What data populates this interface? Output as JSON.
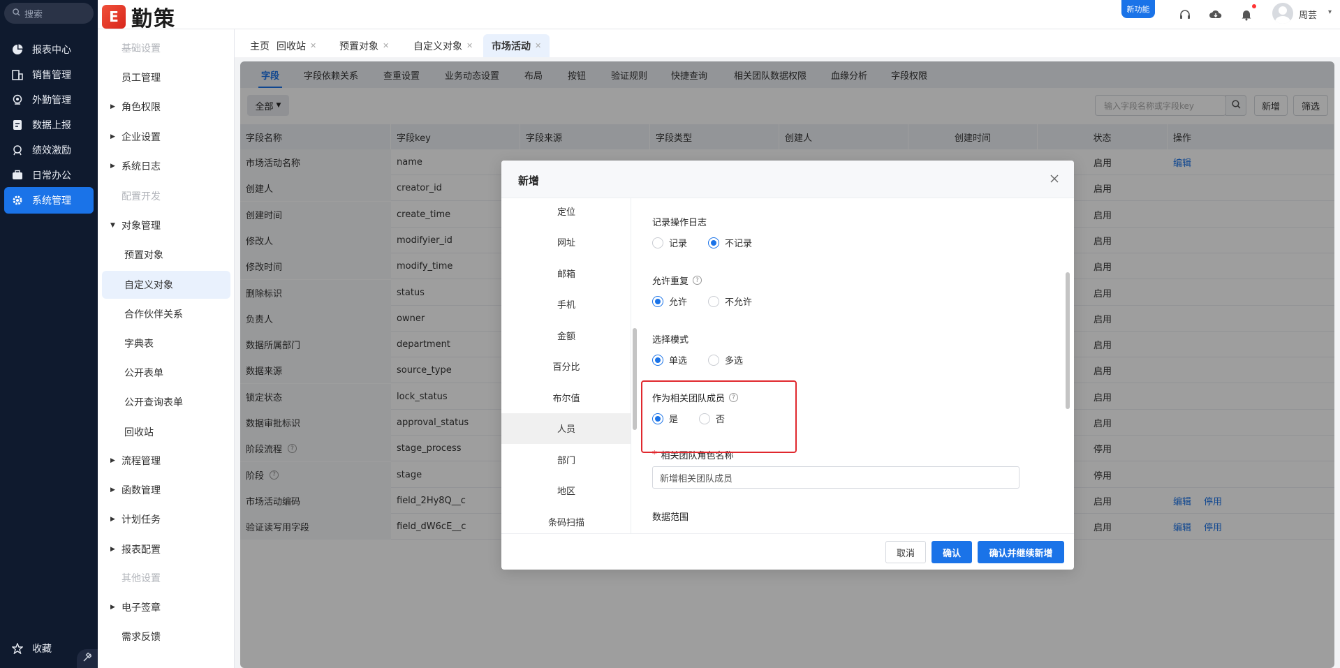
{
  "nav": {
    "search_placeholder": "搜索",
    "items": [
      {
        "label": "报表中心",
        "icon": "pie-chart-icon"
      },
      {
        "label": "销售管理",
        "icon": "building-icon"
      },
      {
        "label": "外勤管理",
        "icon": "location-icon"
      },
      {
        "label": "数据上报",
        "icon": "report-icon"
      },
      {
        "label": "绩效激励",
        "icon": "medal-icon"
      },
      {
        "label": "日常办公",
        "icon": "briefcase-icon"
      },
      {
        "label": "系统管理",
        "icon": "gear-icon",
        "active": true
      }
    ],
    "favorites_label": "收藏"
  },
  "brand": {
    "name": "勤策",
    "mark": "E"
  },
  "topbar": {
    "new_feature": "新功能",
    "username": "周芸"
  },
  "side": {
    "items": [
      {
        "label": "基础设置",
        "type": "group"
      },
      {
        "label": "员工管理",
        "type": "item"
      },
      {
        "label": "角色权限",
        "type": "collapsed"
      },
      {
        "label": "企业设置",
        "type": "collapsed"
      },
      {
        "label": "系统日志",
        "type": "collapsed"
      },
      {
        "label": "配置开发",
        "type": "group"
      },
      {
        "label": "对象管理",
        "type": "expanded"
      },
      {
        "label": "预置对象",
        "type": "sub"
      },
      {
        "label": "自定义对象",
        "type": "sub",
        "active": true
      },
      {
        "label": "合作伙伴关系",
        "type": "sub"
      },
      {
        "label": "字典表",
        "type": "sub"
      },
      {
        "label": "公开表单",
        "type": "sub"
      },
      {
        "label": "公开查询表单",
        "type": "sub"
      },
      {
        "label": "回收站",
        "type": "sub"
      },
      {
        "label": "流程管理",
        "type": "collapsed"
      },
      {
        "label": "函数管理",
        "type": "collapsed"
      },
      {
        "label": "计划任务",
        "type": "collapsed"
      },
      {
        "label": "报表配置",
        "type": "collapsed"
      },
      {
        "label": "其他设置",
        "type": "group"
      },
      {
        "label": "电子签章",
        "type": "collapsed"
      },
      {
        "label": "需求反馈",
        "type": "item"
      }
    ]
  },
  "page_tabs": [
    {
      "label": "主页",
      "closable": false
    },
    {
      "label": "回收站",
      "closable": true
    },
    {
      "label": "预置对象",
      "closable": true
    },
    {
      "label": "自定义对象",
      "closable": true
    },
    {
      "label": "市场活动",
      "closable": true,
      "active": true
    }
  ],
  "field_tabs": [
    "字段",
    "字段依赖关系",
    "查重设置",
    "业务动态设置",
    "布局",
    "按钮",
    "验证规则",
    "快捷查询",
    "相关团队数据权限",
    "血缘分析",
    "字段权限"
  ],
  "toolbar": {
    "filter_all": "全部",
    "search_placeholder": "输入字段名称或字段key",
    "add_label": "新增",
    "filter_label": "筛选"
  },
  "table": {
    "columns": [
      "字段名称",
      "字段key",
      "字段来源",
      "字段类型",
      "创建人",
      "创建时间",
      "状态",
      "操作"
    ],
    "rows": [
      {
        "name": "市场活动名称",
        "key": "name",
        "source": "",
        "type": "",
        "creator": "",
        "created": "",
        "status": "启用",
        "actions": [
          "编辑"
        ]
      },
      {
        "name": "创建人",
        "key": "creator_id",
        "status": "启用",
        "actions": []
      },
      {
        "name": "创建时间",
        "key": "create_time",
        "status": "启用",
        "actions": []
      },
      {
        "name": "修改人",
        "key": "modifyier_id",
        "status": "启用",
        "actions": []
      },
      {
        "name": "修改时间",
        "key": "modify_time",
        "status": "启用",
        "actions": []
      },
      {
        "name": "删除标识",
        "key": "status",
        "status": "启用",
        "actions": []
      },
      {
        "name": "负责人",
        "key": "owner",
        "status": "启用",
        "actions": []
      },
      {
        "name": "数据所属部门",
        "key": "department",
        "status": "启用",
        "actions": []
      },
      {
        "name": "数据来源",
        "key": "source_type",
        "status": "启用",
        "actions": []
      },
      {
        "name": "锁定状态",
        "key": "lock_status",
        "status": "启用",
        "actions": []
      },
      {
        "name": "数据审批标识",
        "key": "approval_status",
        "status": "启用",
        "actions": []
      },
      {
        "name": "阶段流程",
        "key": "stage_process",
        "status": "停用",
        "help": true,
        "actions": []
      },
      {
        "name": "阶段",
        "key": "stage",
        "status": "停用",
        "help": true,
        "actions": []
      },
      {
        "name": "市场活动编码",
        "key": "field_2Hy8Q__c",
        "status": "启用",
        "actions": [
          "编辑",
          "停用"
        ]
      },
      {
        "name": "验证读写用字段",
        "key": "field_dW6cE__c",
        "status": "启用",
        "actions": [
          "编辑",
          "停用"
        ]
      }
    ]
  },
  "modal": {
    "title": "新增",
    "field_types": [
      "定位",
      "网址",
      "邮箱",
      "手机",
      "金额",
      "百分比",
      "布尔值",
      "人员",
      "部门",
      "地区",
      "条码扫描"
    ],
    "active_type": "人员",
    "sections": {
      "log": {
        "label": "记录操作日志",
        "options": [
          "记录",
          "不记录"
        ],
        "selected": 1
      },
      "duplicate": {
        "label": "允许重复",
        "options": [
          "允许",
          "不允许"
        ],
        "selected": 0
      },
      "select_mode": {
        "label": "选择模式",
        "options": [
          "单选",
          "多选"
        ],
        "selected": 0
      },
      "team_member": {
        "label": "作为相关团队成员",
        "options": [
          "是",
          "否"
        ],
        "selected": 0
      },
      "role_name": {
        "label": "相关团队角色名称",
        "value": "新增相关团队成员"
      },
      "data_range": {
        "label": "数据范围"
      }
    },
    "buttons": {
      "cancel": "取消",
      "confirm": "确认",
      "confirm_continue": "确认并继续新增"
    }
  },
  "colors": {
    "accent": "#1a73e8",
    "nav_bg": "#0f1a2e",
    "highlight": "#e0282e"
  }
}
